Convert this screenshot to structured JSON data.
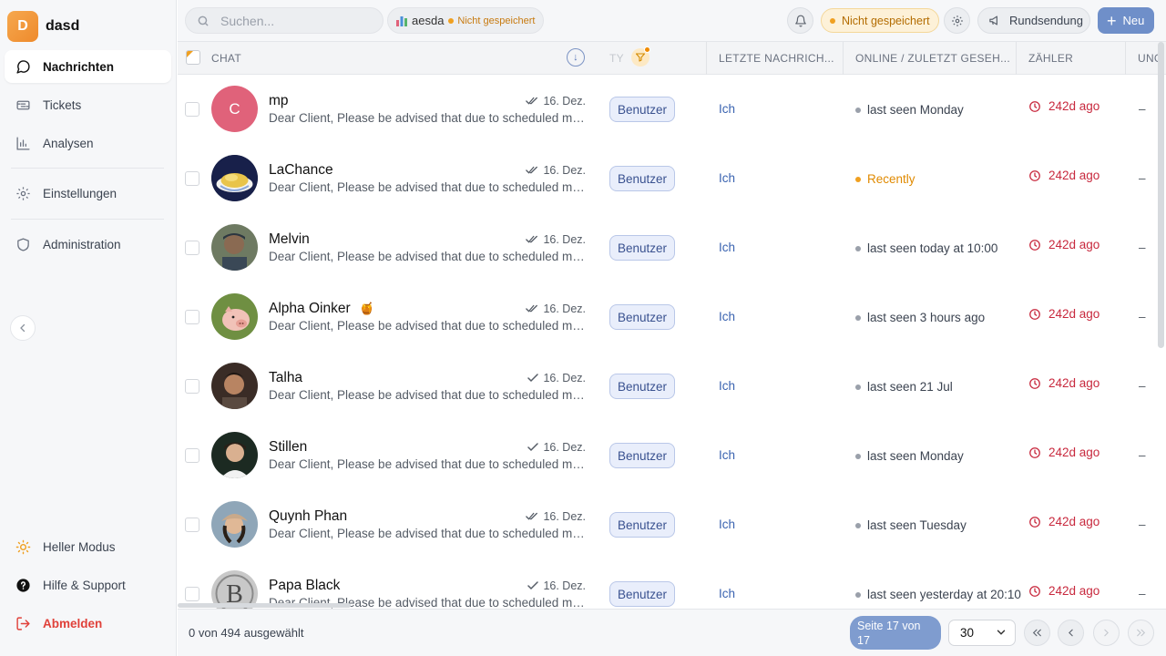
{
  "brand": {
    "initial": "D",
    "name": "dasd"
  },
  "sidebar": {
    "items": [
      {
        "label": "Nachrichten",
        "icon": "message-icon",
        "active": true
      },
      {
        "label": "Tickets",
        "icon": "ticket-icon"
      },
      {
        "label": "Analysen",
        "icon": "chart-icon"
      },
      {
        "label": "Einstellungen",
        "icon": "gear-icon"
      },
      {
        "label": "Administration",
        "icon": "shield-icon"
      }
    ],
    "bottom": [
      {
        "label": "Heller Modus",
        "icon": "sun-icon"
      },
      {
        "label": "Hilfe & Support",
        "icon": "help-icon"
      },
      {
        "label": "Abmelden",
        "icon": "logout-icon"
      }
    ]
  },
  "topbar": {
    "search_placeholder": "Suchen...",
    "view_name": "aesda",
    "view_unsaved": "Nicht gespeichert",
    "unsaved_label": "Nicht gespeichert",
    "broadcast_label": "Rundsendung",
    "new_label": "Neu"
  },
  "table": {
    "headers": {
      "chat": "CHAT",
      "type": "TY",
      "last_message": "LETZTE NACHRICH...",
      "online": "ONLINE / ZULETZT GESEH...",
      "counter": "ZÄHLER",
      "unk": "UNG"
    },
    "rows": [
      {
        "name": "mp",
        "avatar": "C",
        "avatar_type": "letter",
        "preview": "Dear Client, Please be advised that due to scheduled ma...",
        "date": "16. Dez.",
        "double_check": true,
        "type": "Benutzer",
        "last_message": "Ich",
        "online": "last seen Monday",
        "recent": false,
        "counter": "242d ago",
        "unk": "–"
      },
      {
        "name": "LaChance",
        "avatar_type": "food",
        "preview": "Dear Client, Please be advised that due to scheduled ma...",
        "date": "16. Dez.",
        "double_check": true,
        "type": "Benutzer",
        "last_message": "Ich",
        "online": "Recently",
        "recent": true,
        "counter": "242d ago",
        "unk": "–"
      },
      {
        "name": "Melvin",
        "avatar_type": "photo",
        "preview": "Dear Client, Please be advised that due to scheduled ma...",
        "date": "16. Dez.",
        "double_check": true,
        "type": "Benutzer",
        "last_message": "Ich",
        "online": "last seen today at 10:00",
        "recent": false,
        "counter": "242d ago",
        "unk": "–"
      },
      {
        "name": "Alpha Oinker",
        "emoji": "🍯",
        "avatar_type": "pig",
        "preview": "Dear Client, Please be advised that due to scheduled ma...",
        "date": "16. Dez.",
        "double_check": true,
        "type": "Benutzer",
        "last_message": "Ich",
        "online": "last seen 3 hours ago",
        "recent": false,
        "counter": "242d ago",
        "unk": "–"
      },
      {
        "name": "Talha",
        "avatar_type": "photo",
        "preview": "Dear Client, Please be advised that due to scheduled ma...",
        "date": "16. Dez.",
        "double_check": false,
        "type": "Benutzer",
        "last_message": "Ich",
        "online": "last seen 21 Jul",
        "recent": false,
        "counter": "242d ago",
        "unk": "–"
      },
      {
        "name": "Stillen",
        "avatar_type": "photo",
        "preview": "Dear Client, Please be advised that due to scheduled ma...",
        "date": "16. Dez.",
        "double_check": false,
        "type": "Benutzer",
        "last_message": "Ich",
        "online": "last seen Monday",
        "recent": false,
        "counter": "242d ago",
        "unk": "–"
      },
      {
        "name": "Quynh Phan",
        "avatar_type": "photo",
        "preview": "Dear Client, Please be advised that due to scheduled ma...",
        "date": "16. Dez.",
        "double_check": true,
        "type": "Benutzer",
        "last_message": "Ich",
        "online": "last seen Tuesday",
        "recent": false,
        "counter": "242d ago",
        "unk": "–"
      },
      {
        "name": "Papa Black",
        "avatar_type": "monogram",
        "preview": "Dear Client, Please be advised that due to scheduled ma...",
        "date": "16. Dez.",
        "double_check": false,
        "type": "Benutzer",
        "last_message": "Ich",
        "online": "last seen yesterday at 20:10",
        "recent": false,
        "counter": "242d ago",
        "unk": "–"
      }
    ]
  },
  "footer": {
    "selected": "0 von 494 ausgewählt",
    "page": "Seite 17 von 17",
    "per_page": "30"
  },
  "colors": {
    "accent": "#6f8fc9",
    "brand": "#f0a020",
    "danger": "#c8293e"
  }
}
